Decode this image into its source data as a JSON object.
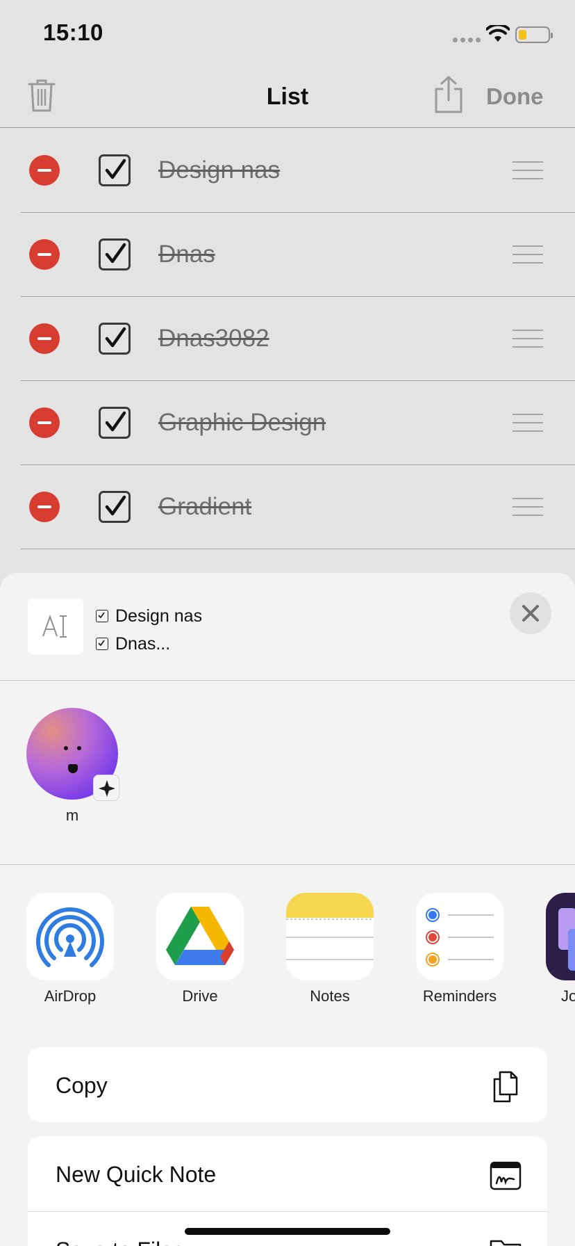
{
  "status_bar": {
    "time": "15:10"
  },
  "nav": {
    "title": "List",
    "done_label": "Done"
  },
  "list_items": [
    {
      "text": "Design nas"
    },
    {
      "text": "Dnas"
    },
    {
      "text": "Dnas3082"
    },
    {
      "text": "Graphic Design"
    },
    {
      "text": "Gradient"
    }
  ],
  "share_sheet": {
    "preview_lines": [
      "Design nas",
      "Dnas..."
    ],
    "people": [
      {
        "name": "m"
      }
    ],
    "apps": [
      {
        "label": "AirDrop",
        "icon": "airdrop-icon"
      },
      {
        "label": "Drive",
        "icon": "google-drive-icon"
      },
      {
        "label": "Notes",
        "icon": "notes-icon"
      },
      {
        "label": "Reminders",
        "icon": "reminders-icon"
      },
      {
        "label": "Jo",
        "icon": "journal-icon"
      }
    ],
    "actions": [
      {
        "label": "Copy",
        "icon": "copy-icon"
      },
      {
        "label": "New Quick Note",
        "icon": "quick-note-icon"
      },
      {
        "label": "Save to Files",
        "icon": "folder-icon"
      }
    ]
  },
  "colors": {
    "delete_red": "#d73d30",
    "sheet_background": "#f4f3f3",
    "done_gray": "#8c8c8e"
  }
}
